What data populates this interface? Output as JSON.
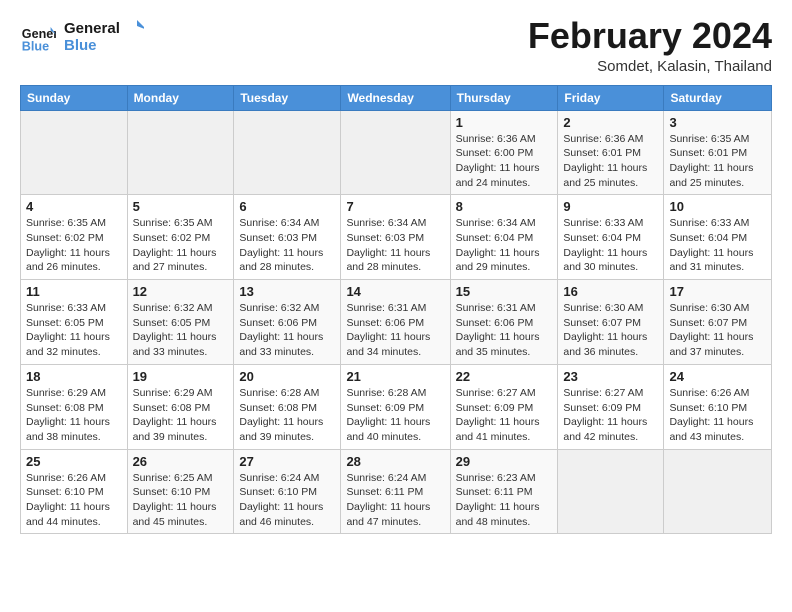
{
  "logo": {
    "line1": "General",
    "line2": "Blue"
  },
  "title": "February 2024",
  "location": "Somdet, Kalasin, Thailand",
  "days_header": [
    "Sunday",
    "Monday",
    "Tuesday",
    "Wednesday",
    "Thursday",
    "Friday",
    "Saturday"
  ],
  "weeks": [
    [
      {
        "num": "",
        "info": ""
      },
      {
        "num": "",
        "info": ""
      },
      {
        "num": "",
        "info": ""
      },
      {
        "num": "",
        "info": ""
      },
      {
        "num": "1",
        "info": "Sunrise: 6:36 AM\nSunset: 6:00 PM\nDaylight: 11 hours\nand 24 minutes."
      },
      {
        "num": "2",
        "info": "Sunrise: 6:36 AM\nSunset: 6:01 PM\nDaylight: 11 hours\nand 25 minutes."
      },
      {
        "num": "3",
        "info": "Sunrise: 6:35 AM\nSunset: 6:01 PM\nDaylight: 11 hours\nand 25 minutes."
      }
    ],
    [
      {
        "num": "4",
        "info": "Sunrise: 6:35 AM\nSunset: 6:02 PM\nDaylight: 11 hours\nand 26 minutes."
      },
      {
        "num": "5",
        "info": "Sunrise: 6:35 AM\nSunset: 6:02 PM\nDaylight: 11 hours\nand 27 minutes."
      },
      {
        "num": "6",
        "info": "Sunrise: 6:34 AM\nSunset: 6:03 PM\nDaylight: 11 hours\nand 28 minutes."
      },
      {
        "num": "7",
        "info": "Sunrise: 6:34 AM\nSunset: 6:03 PM\nDaylight: 11 hours\nand 28 minutes."
      },
      {
        "num": "8",
        "info": "Sunrise: 6:34 AM\nSunset: 6:04 PM\nDaylight: 11 hours\nand 29 minutes."
      },
      {
        "num": "9",
        "info": "Sunrise: 6:33 AM\nSunset: 6:04 PM\nDaylight: 11 hours\nand 30 minutes."
      },
      {
        "num": "10",
        "info": "Sunrise: 6:33 AM\nSunset: 6:04 PM\nDaylight: 11 hours\nand 31 minutes."
      }
    ],
    [
      {
        "num": "11",
        "info": "Sunrise: 6:33 AM\nSunset: 6:05 PM\nDaylight: 11 hours\nand 32 minutes."
      },
      {
        "num": "12",
        "info": "Sunrise: 6:32 AM\nSunset: 6:05 PM\nDaylight: 11 hours\nand 33 minutes."
      },
      {
        "num": "13",
        "info": "Sunrise: 6:32 AM\nSunset: 6:06 PM\nDaylight: 11 hours\nand 33 minutes."
      },
      {
        "num": "14",
        "info": "Sunrise: 6:31 AM\nSunset: 6:06 PM\nDaylight: 11 hours\nand 34 minutes."
      },
      {
        "num": "15",
        "info": "Sunrise: 6:31 AM\nSunset: 6:06 PM\nDaylight: 11 hours\nand 35 minutes."
      },
      {
        "num": "16",
        "info": "Sunrise: 6:30 AM\nSunset: 6:07 PM\nDaylight: 11 hours\nand 36 minutes."
      },
      {
        "num": "17",
        "info": "Sunrise: 6:30 AM\nSunset: 6:07 PM\nDaylight: 11 hours\nand 37 minutes."
      }
    ],
    [
      {
        "num": "18",
        "info": "Sunrise: 6:29 AM\nSunset: 6:08 PM\nDaylight: 11 hours\nand 38 minutes."
      },
      {
        "num": "19",
        "info": "Sunrise: 6:29 AM\nSunset: 6:08 PM\nDaylight: 11 hours\nand 39 minutes."
      },
      {
        "num": "20",
        "info": "Sunrise: 6:28 AM\nSunset: 6:08 PM\nDaylight: 11 hours\nand 39 minutes."
      },
      {
        "num": "21",
        "info": "Sunrise: 6:28 AM\nSunset: 6:09 PM\nDaylight: 11 hours\nand 40 minutes."
      },
      {
        "num": "22",
        "info": "Sunrise: 6:27 AM\nSunset: 6:09 PM\nDaylight: 11 hours\nand 41 minutes."
      },
      {
        "num": "23",
        "info": "Sunrise: 6:27 AM\nSunset: 6:09 PM\nDaylight: 11 hours\nand 42 minutes."
      },
      {
        "num": "24",
        "info": "Sunrise: 6:26 AM\nSunset: 6:10 PM\nDaylight: 11 hours\nand 43 minutes."
      }
    ],
    [
      {
        "num": "25",
        "info": "Sunrise: 6:26 AM\nSunset: 6:10 PM\nDaylight: 11 hours\nand 44 minutes."
      },
      {
        "num": "26",
        "info": "Sunrise: 6:25 AM\nSunset: 6:10 PM\nDaylight: 11 hours\nand 45 minutes."
      },
      {
        "num": "27",
        "info": "Sunrise: 6:24 AM\nSunset: 6:10 PM\nDaylight: 11 hours\nand 46 minutes."
      },
      {
        "num": "28",
        "info": "Sunrise: 6:24 AM\nSunset: 6:11 PM\nDaylight: 11 hours\nand 47 minutes."
      },
      {
        "num": "29",
        "info": "Sunrise: 6:23 AM\nSunset: 6:11 PM\nDaylight: 11 hours\nand 48 minutes."
      },
      {
        "num": "",
        "info": ""
      },
      {
        "num": "",
        "info": ""
      }
    ]
  ]
}
